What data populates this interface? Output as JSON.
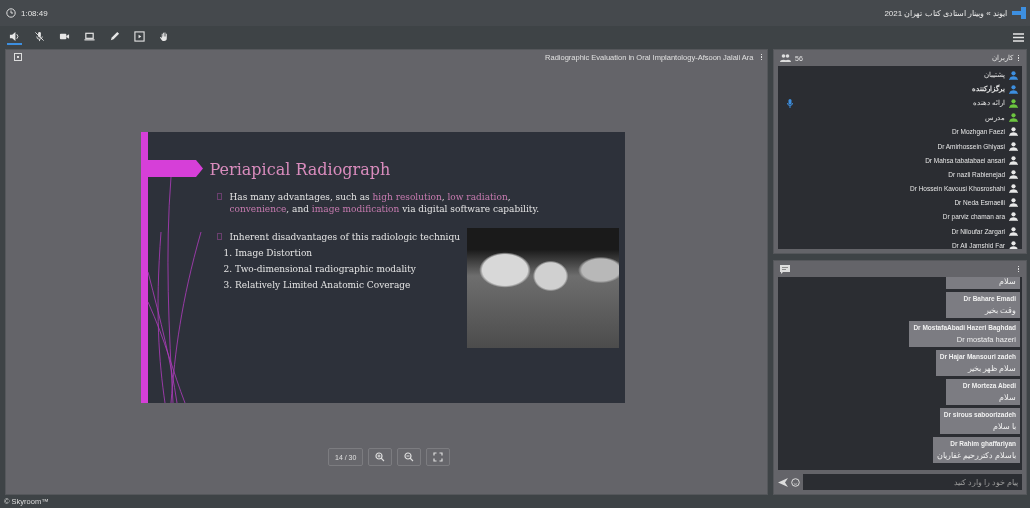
{
  "topbar": {
    "timer": "1:08:49",
    "title": "ایوند » وبینار استادی کتاب تهران 2021"
  },
  "toolbar": {
    "tools": [
      {
        "kind": "speaker",
        "selected": true
      },
      {
        "kind": "mic-off",
        "selected": false
      },
      {
        "kind": "camera",
        "selected": false
      },
      {
        "kind": "screen",
        "selected": false
      },
      {
        "kind": "pen",
        "selected": false
      },
      {
        "kind": "media",
        "selected": false
      },
      {
        "kind": "hand",
        "selected": false
      }
    ]
  },
  "stage": {
    "title": "Radiographic Evaluation in Oral Implantology-Afsoon Jalali Ara",
    "slide": {
      "title": "Periapical Radiograph",
      "bullets": [
        {
          "segments": [
            {
              "text": "Has many advantages, such as ",
              "highlight": false
            },
            {
              "text": "high resolution",
              "highlight": true
            },
            {
              "text": ", ",
              "highlight": false
            },
            {
              "text": "low radiation",
              "highlight": true
            },
            {
              "text": ", ",
              "highlight": false
            },
            {
              "text": "convenience",
              "highlight": true
            },
            {
              "text": ", and ",
              "highlight": false
            },
            {
              "text": "image modification",
              "highlight": true
            },
            {
              "text": " via digital software capability.",
              "highlight": false
            }
          ]
        },
        {
          "segments": [
            {
              "text": "Inherent disadvantages of this radiologic techniqu",
              "highlight": false
            }
          ]
        }
      ],
      "numbered": [
        "1. Image Distortion",
        "2. Two-dimensional radiographic modality",
        "3. Relatively Limited Anatomic Coverage"
      ]
    },
    "page": "14 / 30"
  },
  "users": {
    "count": "56",
    "title": "کاربران",
    "items": [
      {
        "name": "پشتیبان",
        "kind": "support",
        "mic": false
      },
      {
        "name": "برگزارکننده",
        "kind": "organizer",
        "mic": false
      },
      {
        "name": "ارائه دهنده",
        "kind": "presenter",
        "mic": true
      },
      {
        "name": "مدرس",
        "kind": "teacher",
        "mic": false
      },
      {
        "name": "Dr Mozhgan Faezi",
        "kind": "attendee",
        "mic": false
      },
      {
        "name": "Dr Amirhossein Ghiyasi",
        "kind": "attendee",
        "mic": false
      },
      {
        "name": "Dr Mahsa tabatabaei ansari",
        "kind": "attendee",
        "mic": false
      },
      {
        "name": "Dr nazli Rabienejad",
        "kind": "attendee",
        "mic": false
      },
      {
        "name": "Dr Hossein Kavousi Khosroshahi",
        "kind": "attendee",
        "mic": false
      },
      {
        "name": "Dr Neda Esmaeili",
        "kind": "attendee",
        "mic": false
      },
      {
        "name": "Dr parviz chaman ara",
        "kind": "attendee",
        "mic": false
      },
      {
        "name": "Dr Niloufar Zargari",
        "kind": "attendee",
        "mic": false
      },
      {
        "name": "Dr Ali Jamshid Far",
        "kind": "attendee",
        "mic": false
      }
    ]
  },
  "chat": {
    "messages": [
      {
        "text": "سلام"
      },
      {
        "sender": "Dr Bahare Emadi",
        "text": "وقت بخیر"
      },
      {
        "sender": "Dr MostafaAbadi Hazeri Baghdad",
        "text": "Dr mostafa hazeri"
      },
      {
        "sender": "Dr Hajar Mansouri zadeh",
        "text": "سلام ظهر بخیر"
      },
      {
        "sender": "Dr Morteza Abedi",
        "text": "سلام"
      },
      {
        "sender": "Dr sirous saboorizadeh",
        "text": "با سلام"
      },
      {
        "sender": "Dr Rahim ghaffariyan",
        "text": "باسلام دکتررحیم غفاریان"
      }
    ],
    "placeholder": "پیام خود را وارد کنید"
  },
  "footer": "© Skyroom™"
}
